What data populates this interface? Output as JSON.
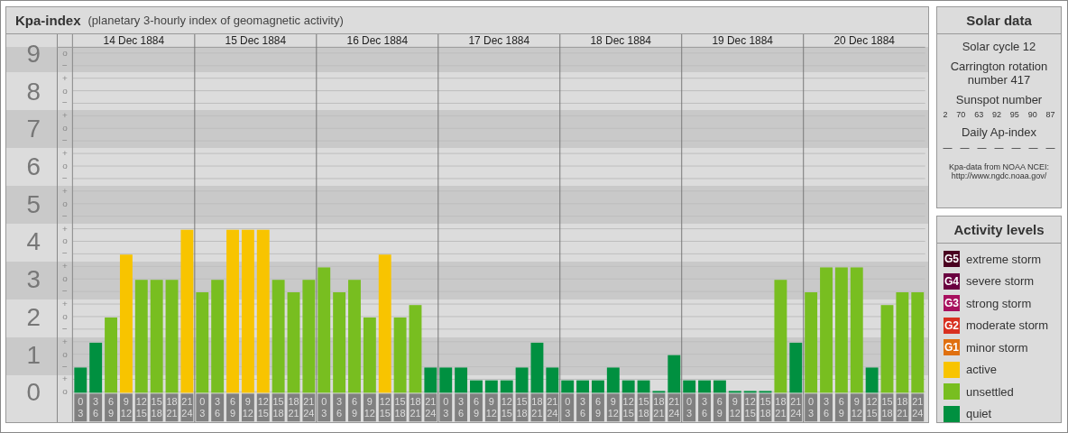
{
  "main_panel": {
    "title": "Kpa-index",
    "subtitle": "(planetary 3-hourly index of geomagnetic activity)",
    "days": [
      "14 Dec 1884",
      "15 Dec 1884",
      "16 Dec 1884",
      "17 Dec 1884",
      "18 Dec 1884",
      "19 Dec 1884",
      "20 Dec 1884"
    ],
    "levels": [
      {
        "marks": [
          "o",
          "−"
        ]
      },
      {
        "marks": [
          "+",
          "o",
          "−"
        ]
      },
      {
        "marks": [
          "+",
          "o",
          "−"
        ]
      },
      {
        "marks": [
          "+",
          "o",
          "−"
        ]
      },
      {
        "marks": [
          "+",
          "o",
          "−"
        ]
      },
      {
        "marks": [
          "+",
          "o",
          "−"
        ]
      },
      {
        "marks": [
          "+",
          "o",
          "−"
        ]
      },
      {
        "marks": [
          "+",
          "o",
          "−"
        ]
      },
      {
        "marks": [
          "+",
          "o",
          "−"
        ]
      },
      {
        "marks": [
          "+",
          "o"
        ]
      }
    ],
    "chart_data": {
      "type": "bar",
      "ylim": [
        0,
        9
      ],
      "grid": true,
      "yticks": [
        9,
        8,
        7,
        6,
        5,
        4,
        3,
        2,
        1,
        0
      ],
      "categories": [
        "0 3",
        "3 6",
        "6 9",
        "9 12",
        "12 15",
        "15 18",
        "18 21",
        "21 24",
        "0 3",
        "3 6",
        "6 9",
        "9 12",
        "12 15",
        "15 18",
        "18 21",
        "21 24",
        "0 3",
        "3 6",
        "6 9",
        "9 12",
        "12 15",
        "15 18",
        "18 21",
        "21 24",
        "0 3",
        "3 6",
        "6 9",
        "9 12",
        "12 15",
        "15 18",
        "18 21",
        "21 24",
        "0 3",
        "3 6",
        "6 9",
        "9 12",
        "12 15",
        "15 18",
        "18 21",
        "21 24",
        "0 3",
        "3 6",
        "6 9",
        "9 12",
        "12 15",
        "15 18",
        "18 21",
        "21 24",
        "0 3",
        "3 6",
        "6 9",
        "9 12",
        "12 15",
        "15 18",
        "18 21",
        "21 24"
      ],
      "series": [
        {
          "name": "quiet",
          "color": "#009040",
          "values": [
            0.67,
            1.33,
            null,
            null,
            null,
            null,
            null,
            null,
            null,
            null,
            null,
            null,
            null,
            null,
            null,
            null,
            null,
            null,
            null,
            null,
            null,
            null,
            null,
            0.67,
            0.67,
            0.67,
            0.33,
            0.33,
            0.33,
            0.67,
            1.33,
            0.67,
            0.33,
            0.33,
            0.33,
            0.67,
            0.33,
            0.33,
            0,
            1,
            0.33,
            0.33,
            0.33,
            0,
            0,
            0,
            null,
            1.33,
            null,
            null,
            null,
            null,
            0.67,
            null,
            null,
            null
          ]
        },
        {
          "name": "unsettled",
          "color": "#78be20",
          "values": [
            null,
            null,
            2,
            null,
            3,
            3,
            3,
            null,
            2.67,
            3,
            null,
            null,
            null,
            3,
            2.67,
            3,
            3.33,
            2.67,
            3,
            2,
            null,
            2,
            2.33,
            null,
            null,
            null,
            null,
            null,
            null,
            null,
            null,
            null,
            null,
            null,
            null,
            null,
            null,
            null,
            null,
            null,
            null,
            null,
            null,
            null,
            null,
            null,
            3,
            null,
            2.67,
            3.33,
            3.33,
            3.33,
            null,
            2.33,
            2.67,
            2.67
          ]
        },
        {
          "name": "active",
          "color": "#f8c400",
          "values": [
            null,
            null,
            null,
            3.67,
            null,
            null,
            null,
            4.33,
            null,
            null,
            4.33,
            4.33,
            4.33,
            null,
            null,
            null,
            null,
            null,
            null,
            null,
            3.67,
            null,
            null,
            null,
            null,
            null,
            null,
            null,
            null,
            null,
            null,
            null,
            null,
            null,
            null,
            null,
            null,
            null,
            null,
            null,
            null,
            null,
            null,
            null,
            null,
            null,
            null,
            null,
            null,
            null,
            null,
            null,
            null,
            null,
            null,
            null
          ]
        }
      ]
    }
  },
  "solar_data": {
    "title": "Solar data",
    "cycle": "Solar cycle 12",
    "rotation": "Carrington rotation number 417",
    "sunspot_label": "Sunspot number",
    "sunspots": [
      "2",
      "70",
      "63",
      "92",
      "95",
      "90",
      "87"
    ],
    "ap_label": "Daily Ap-index",
    "ap_values": [
      "—",
      "—",
      "—",
      "—",
      "—",
      "—",
      "—"
    ],
    "source": "Kpa-data from NOAA NCEI:",
    "source_url": "http://www.ngdc.noaa.gov/"
  },
  "activity_levels": {
    "title": "Activity levels",
    "items": [
      {
        "badge": "G5",
        "label": "extreme storm",
        "color": "#4a0020"
      },
      {
        "badge": "G4",
        "label": "severe storm",
        "color": "#6a0040"
      },
      {
        "badge": "G3",
        "label": "strong storm",
        "color": "#a8105e"
      },
      {
        "badge": "G2",
        "label": "moderate storm",
        "color": "#d83020"
      },
      {
        "badge": "G1",
        "label": "minor storm",
        "color": "#e07010"
      }
    ]
  }
}
